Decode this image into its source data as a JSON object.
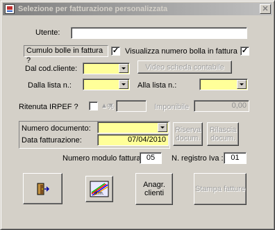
{
  "window": {
    "title": "Selezione per fatturazione personalizzata",
    "close_label": "✕"
  },
  "form": {
    "utente_label": "Utente:",
    "utente_value": "",
    "cumulo_label": "Cumulo bolle in fattura ?",
    "cumulo_checked": "✓",
    "visualizza_label": "Visualizza numero bolla in fattura",
    "visualizza_checked": "✓",
    "cod_cliente_label": "Dal cod.cliente:",
    "video_scheda_label": "Video scheda contabile",
    "dalla_lista_label": "Dalla lista n.:",
    "alla_lista_label": "Alla lista n.:",
    "ritenuta_label": "Ritenuta  IRPEF ?",
    "ritenuta_percent": "%",
    "imponibile_label": "Imponibile",
    "imponibile_value": "0,00",
    "numero_documento_label": "Numero documento:",
    "data_fatturazione_label": "Data fatturazione:",
    "data_fatturazione_value": "07/04/2010",
    "riserva_label": "Riserva docum.",
    "rilascia_label": "Rilascia docum.",
    "modulo_label": "Numero modulo fattura:",
    "modulo_value": "05",
    "registro_label": "N. registro Iva :",
    "registro_value": "01"
  },
  "toolbar": {
    "exit_icon": "exit-door-icon",
    "chart_icon": "chart-icon",
    "anagr_label": "Anagr. clienti",
    "stampa_label": "Stampa fatture"
  }
}
